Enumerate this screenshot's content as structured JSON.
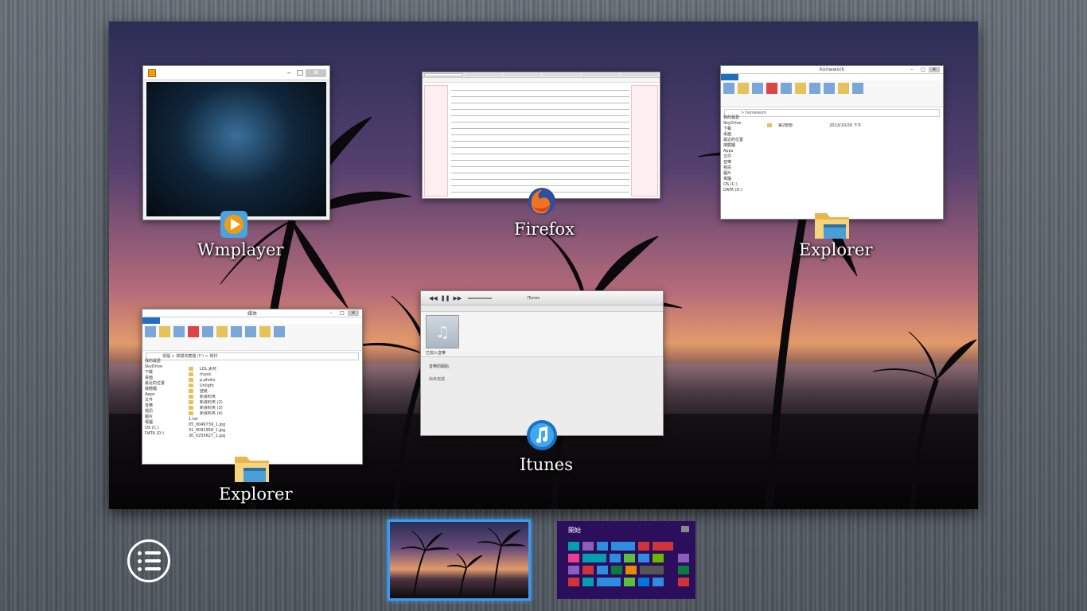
{
  "windows": [
    {
      "id": "wmplayer",
      "label": "Wmplayer",
      "title": ""
    },
    {
      "id": "firefox",
      "label": "Firefox",
      "title": ""
    },
    {
      "id": "explorer-homework",
      "label": "Explorer",
      "title": "homework"
    },
    {
      "id": "explorer-media",
      "label": "Explorer",
      "title": "媒体"
    },
    {
      "id": "itunes",
      "label": "Itunes",
      "title": "iTunes"
    }
  ],
  "explorer_homework": {
    "path": "> homework",
    "nav": [
      "我的最愛",
      "SkyDrive",
      "下載",
      "桌面",
      "最近的位置",
      "媒體櫃",
      "Apps",
      "文件",
      "音樂",
      "視訊",
      "圖片",
      "電腦",
      "OS (C:)",
      "DATA (D:)"
    ],
    "files": [
      {
        "name": "第2部部",
        "date": "2013/10/26 下午"
      }
    ]
  },
  "explorer_media": {
    "path": "電腦 > 媒體收藏櫃 (F:) > 媒材",
    "nav": [
      "我的最愛",
      "SkyDrive",
      "下載",
      "桌面",
      "最近的位置",
      "媒體櫃",
      "Apps",
      "文件",
      "音樂",
      "視訊",
      "圖片",
      "電腦",
      "OS (C:)",
      "DATA (D:)"
    ],
    "files": [
      "LOL 素材",
      "music",
      "p.photo",
      "Unlight",
      "壁紙",
      "新資料夾",
      "新資料夾 (2)",
      "新資料夾 (3)",
      "新資料夾 (4)",
      "1.txt",
      "05_0049739_1.jpg",
      "31_0091958_1.jpg",
      "30_0255627_1.jpg"
    ]
  },
  "itunes": {
    "now_playing": "iTunes",
    "track": "音樂的開始",
    "status": "已加入音樂",
    "sidebar": "尚未完成"
  },
  "workspaces": [
    {
      "name": "desktop-1",
      "label": ""
    },
    {
      "name": "start-screen",
      "label": "開始"
    }
  ],
  "colors": {
    "accent": "#3a9bf0",
    "start_bg": "#2b0f5c"
  }
}
